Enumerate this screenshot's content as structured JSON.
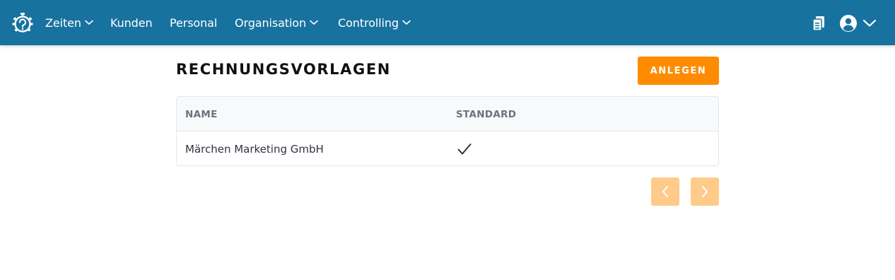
{
  "nav": {
    "zeiten": "Zeiten",
    "kunden": "Kunden",
    "personal": "Personal",
    "organisation": "Organisation",
    "controlling": "Controlling"
  },
  "header": {
    "icons": [
      "stopwatch-logo-icon",
      "clipboard-icon",
      "user-avatar-icon",
      "chevron-down-icon"
    ]
  },
  "page": {
    "title": "RECHNUNGSVORLAGEN",
    "create_label": "ANLEGEN"
  },
  "table": {
    "columns": [
      "NAME",
      "STANDARD"
    ],
    "rows": [
      {
        "name": "Märchen Marketing GmbH",
        "standard": true
      }
    ]
  },
  "colors": {
    "topbar": "#18729f",
    "accent": "#ff8c00",
    "accent_disabled": "#ffcb8a"
  }
}
